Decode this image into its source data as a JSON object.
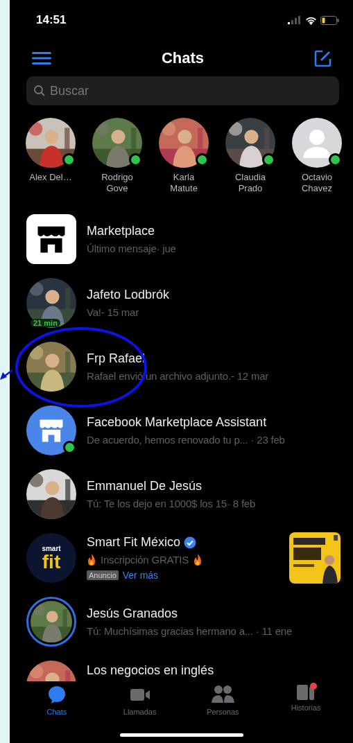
{
  "status_bar": {
    "time": "14:51"
  },
  "header": {
    "title": "Chats"
  },
  "search": {
    "placeholder": "Buscar"
  },
  "stories": [
    {
      "name": "Alex Del…",
      "online": true
    },
    {
      "name": "Rodrigo Gove",
      "online": true
    },
    {
      "name": "Karla Matute",
      "online": true
    },
    {
      "name": "Claudia Prado",
      "online": true
    },
    {
      "name": "Octavio Chavez",
      "kind": "default",
      "online": true
    }
  ],
  "chats": [
    {
      "kind": "marketplace",
      "name": "Marketplace",
      "preview": "Último mensaje· jue",
      "online": false
    },
    {
      "name": "Jafeto Lodbrók",
      "preview": "Va!- 15 mar",
      "online": false,
      "active_badge": "21 min"
    },
    {
      "name": "Frp Rafael",
      "preview": "Rafael envió un archivo adjunto.- 12 mar",
      "online": false
    },
    {
      "kind": "assistant",
      "name": "Facebook Marketplace Assistant",
      "preview": "De acuerdo, hemos renovado tu p... · 23 feb",
      "online": true
    },
    {
      "name": "Emmanuel De Jesús",
      "preview": "Tú: Te los dejo en 1000$ los 15· 8 feb",
      "online": false
    },
    {
      "kind": "ad",
      "name": "Smart Fit México",
      "verified": true,
      "logo_top": "smart",
      "logo_main": "fit",
      "preview": "Inscripción GRATIS",
      "ad_label": "Anuncio",
      "link": "Ver más",
      "online": false
    },
    {
      "name": "Jesús Granados",
      "preview": "Tú: Muchísimas gracias hermano a... · 11 ene",
      "online": false,
      "story_ring": true
    },
    {
      "name": "Los negocios en inglés",
      "online": false
    }
  ],
  "tabs": [
    {
      "label": "Chats",
      "selected": true,
      "notification": false
    },
    {
      "label": "Llamadas",
      "selected": false,
      "notification": false
    },
    {
      "label": "Personas",
      "selected": false,
      "notification": false
    },
    {
      "label": "Historias",
      "selected": false,
      "notification": true
    }
  ]
}
